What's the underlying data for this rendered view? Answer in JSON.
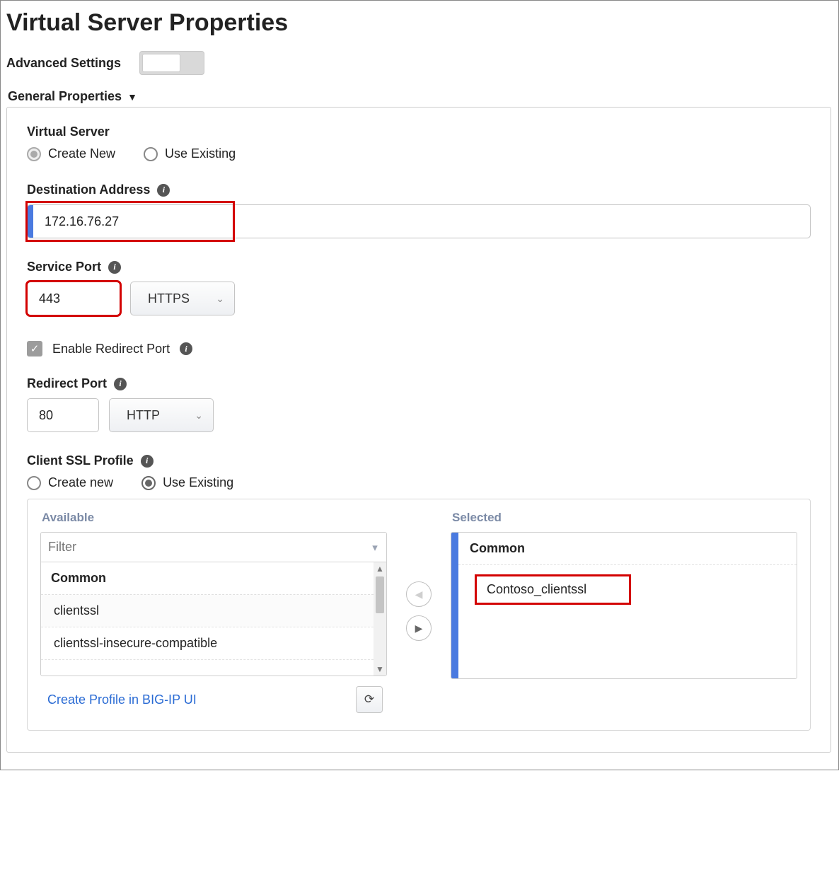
{
  "title": "Virtual Server Properties",
  "advanced": {
    "label": "Advanced Settings",
    "on": false
  },
  "section": {
    "general": "General Properties"
  },
  "virtualServer": {
    "label": "Virtual Server",
    "createNew": "Create New",
    "useExisting": "Use Existing"
  },
  "destAddress": {
    "label": "Destination Address",
    "value": "172.16.76.27"
  },
  "servicePort": {
    "label": "Service Port",
    "value": "443",
    "protocol": "HTTPS"
  },
  "redirectEnable": {
    "label": "Enable Redirect Port",
    "checked": true
  },
  "redirectPort": {
    "label": "Redirect Port",
    "value": "80",
    "protocol": "HTTP"
  },
  "clientSsl": {
    "label": "Client SSL Profile",
    "createNew": "Create new",
    "useExisting": "Use Existing"
  },
  "picker": {
    "availableTitle": "Available",
    "selectedTitle": "Selected",
    "filterPlaceholder": "Filter",
    "groupLabel": "Common",
    "availableItems": [
      "clientssl",
      "clientssl-insecure-compatible"
    ],
    "selectedGroupLabel": "Common",
    "selectedItems": [
      "Contoso_clientssl"
    ],
    "createProfileLink": "Create Profile in BIG-IP UI"
  }
}
